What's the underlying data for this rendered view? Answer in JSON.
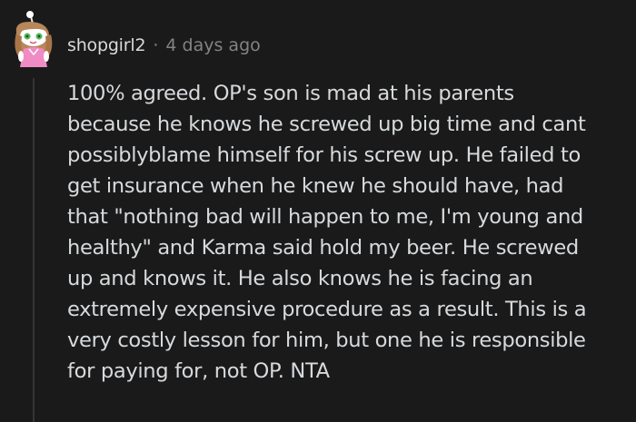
{
  "comment": {
    "author": "shopgirl2",
    "separator": "·",
    "timestamp": "4 days ago",
    "avatar_icon": "snoo-avatar-icon",
    "body_lines": [
      "100% agreed. OP's son is mad at his parents",
      "because he knows he screwed up big time and cant",
      "possiblyblame himself for his screw up. He failed to",
      "get insurance when he knew he should have, had",
      "that \"nothing bad will happen to me, I'm young and",
      "healthy\" and Karma said hold my beer. He screwed",
      "up and knows it. He also knows he is facing an",
      "extremely expensive procedure as a result. This is a",
      "very costly lesson for him, but one he is responsible",
      "for paying for, not OP. NTA"
    ]
  },
  "colors": {
    "background": "#1a1a1b",
    "text_primary": "#d7dadc",
    "text_meta": "#818384",
    "thread_line": "#343536",
    "avatar_hair": "#b8865a",
    "avatar_face": "#ffffff",
    "avatar_dress": "#f08cc4"
  }
}
